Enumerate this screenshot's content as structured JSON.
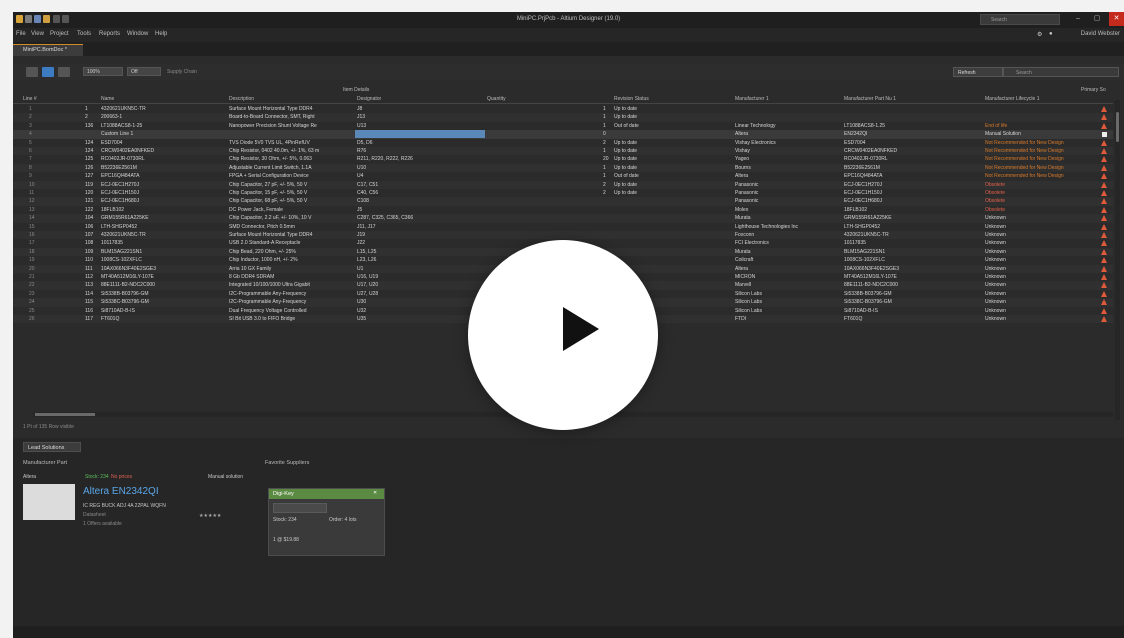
{
  "window": {
    "title": "MiniPC.PrjPcb - Altium Designer (19.0)",
    "search_placeholder": "Search",
    "user_name": "David Webster"
  },
  "menu": [
    "File",
    "View",
    "Project",
    "Tools",
    "Reports",
    "Window",
    "Help"
  ],
  "doc_tab": "MiniPC.BomDoc *",
  "toolbar": {
    "zoom": "100%",
    "filter": "Off",
    "supply_chain": "Supply Chain",
    "refresh_label": "Refresh",
    "search_placeholder": "Search"
  },
  "grid": {
    "group_header": "Item Details",
    "primary_header": "Primary So",
    "columns": [
      "Line #",
      "Name",
      "Description",
      "Designator",
      "Quantity",
      "Revision Status",
      "Manufacturer 1",
      "Manufacturer Part Nu 1",
      "Manufacturer Lifecycle 1"
    ],
    "rows": [
      [
        "1",
        "4320621UKN5C-TR",
        "Surface Mount Horizontal Type DDR4",
        "J8",
        "1",
        "Up to date",
        "",
        "",
        ""
      ],
      [
        "2",
        "200663-1",
        "Board-to-Board Connector, SMT, Right",
        "J13",
        "1",
        "Up to date",
        "",
        "",
        ""
      ],
      [
        "136",
        "LT1088ACS8-1-25",
        "Nanopower Precision Shunt Voltage Re",
        "U13",
        "1",
        "Out of date",
        "Linear Technology",
        "LT1088ACS8-1.25",
        "End of life"
      ],
      [
        "",
        "Custom Line 1",
        "",
        "",
        "0",
        "",
        "Altera",
        "EN2342QI",
        "Manual Solution"
      ],
      [
        "124",
        "ESD7004",
        "TVS Diode 5V0 TVS UL, 4PinRefUV",
        "D5, D6",
        "2",
        "Up to date",
        "Vishay Electronics",
        "ESD7004",
        "Not Recommended for New Design"
      ],
      [
        "124",
        "CRCW0402EA0NFKED",
        "Chip Resistor, 0402 40.0m, +/- 1%, 63 m",
        "R76",
        "1",
        "Up to date",
        "Vishay",
        "CRCW0402EA0NFKED",
        "Not Recommended for New Design"
      ],
      [
        "125",
        "RC0402JR-0730RL",
        "Chip Resistor, 30 Ohm, +/- 5%, 0.063",
        "R211, R220, R222, R226",
        "20",
        "Up to date",
        "Yageo",
        "RC0402JR-0730RL",
        "Not Recommended for New Design"
      ],
      [
        "126",
        "B52236E2561M",
        "Adjustable Current Limit Switch, 1.1A",
        "U10",
        "1",
        "Up to date",
        "Bourns",
        "B52236E2561M",
        "Not Recommended for New Design"
      ],
      [
        "127",
        "EPC16QI484ATA",
        "FPGA + Serial Configuration Device",
        "U4",
        "1",
        "Out of date",
        "Altera",
        "EPC16QI484ATA",
        "Not Recommended for New Design"
      ],
      [
        "119",
        "ECJ-0EC1H270J",
        "Chip Capacitor, 27 pF, +/- 5%, 50 V",
        "C17, C51",
        "2",
        "Up to date",
        "Panasonic",
        "ECJ-0EC1H270J",
        "Obsolete"
      ],
      [
        "120",
        "ECJ-0EC1H150J",
        "Chip Capacitor, 15 pF, +/- 5%, 50 V",
        "C40, C56",
        "2",
        "Up to date",
        "Panasonic",
        "ECJ-0EC1H150J",
        "Obsolete"
      ],
      [
        "121",
        "ECJ-0EC1H680J",
        "Chip Capacitor, 68 pF, +/- 5%, 50 V",
        "C108",
        "",
        "",
        "Panasonic",
        "ECJ-0EC1H680J",
        "Obsolete"
      ],
      [
        "122",
        "18FLB102",
        "DC Power Jack, Female",
        "J5",
        "",
        "",
        "Molex",
        "18FLB102",
        "Obsolete"
      ],
      [
        "104",
        "GRM155R61A225KE",
        "Chip Capacitor, 2.2 uF, +/- 10%, 10 V",
        "C287, C325, C365, C366",
        "",
        "",
        "Murata",
        "GRM155R61A225KE",
        "Unknown"
      ],
      [
        "106",
        "LTH-SHGP0452",
        "SMD Connector, Pitch 0.5mm",
        "J11, J17",
        "",
        "",
        "Lighthouse Technologies Inc",
        "LTH-SHGP0452",
        "Unknown"
      ],
      [
        "107",
        "4320621UKN5C-TR",
        "Surface Mount Horizontal Type DDR4",
        "J19",
        "",
        "",
        "Foxconn",
        "4320621UKN5C-TR",
        "Unknown"
      ],
      [
        "108",
        "10117835",
        "USB 2.0 Standard-A Receptacle",
        "J22",
        "",
        "",
        "FCI Electronics",
        "10117835",
        "Unknown"
      ],
      [
        "109",
        "BLM15AG221SN1",
        "Chip Bead, 220 Ohm, +/- 25%",
        "L15, L25",
        "",
        "",
        "Murata",
        "BLM15AG221SN1",
        "Unknown"
      ],
      [
        "110",
        "1008CS-102XFLC",
        "Chip Inductor, 1000 nH, +/- 2%",
        "L23, L26",
        "",
        "",
        "Coilcraft",
        "1008CS-102XFLC",
        "Unknown"
      ],
      [
        "111",
        "10AX066N3F40E2SGE3",
        "Arria 10 GX Family",
        "U1",
        "",
        "",
        "Altera",
        "10AX066N3F40E2SGE3",
        "Unknown"
      ],
      [
        "112",
        "MT40A512M16LY-107E",
        "8 Gb DDR4 SDRAM",
        "U16, U19",
        "",
        "",
        "MICRON",
        "MT40A512M16LY-107E",
        "Unknown"
      ],
      [
        "113",
        "88E1111-B2-NDC2C000",
        "Integrated 10/100/1000 Ultra Gigabit",
        "U17, U20",
        "",
        "",
        "Marvell",
        "88E1111-B2-NDC2C000",
        "Unknown"
      ],
      [
        "114",
        "Si5338B-B03796-GM",
        "I2C-Programmable Any-Frequency",
        "U27, U28",
        "",
        "",
        "Silicon Labs",
        "Si5338B-B03796-GM",
        "Unknown"
      ],
      [
        "115",
        "Si5338C-B03796-GM",
        "I2C-Programmable Any-Frequency",
        "U30",
        "",
        "",
        "Silicon Labs",
        "Si5338C-B03796-GM",
        "Unknown"
      ],
      [
        "116",
        "Si8710AD-B-IS",
        "Dual Frequency Voltage Controlled",
        "U32",
        "",
        "",
        "Silicon Labs",
        "Si8710AD-B-IS",
        "Unknown"
      ],
      [
        "117",
        "FT601Q",
        "SI Bit USB 3.0 to FIFO Bridge",
        "U35",
        "",
        "",
        "FTDI",
        "FT601Q",
        "Unknown"
      ]
    ],
    "status_line": "1 Pt of 135 Row visible"
  },
  "solutions": {
    "tab_label": "Lead Solutions",
    "mfr_part_header": "Manufacturer Part",
    "favorite_suppliers_header": "Favorite Suppliers",
    "mfr_label": "Altera",
    "stock_label": "Stock: 234",
    "no_price_label": "No prices",
    "manual_solution_label": "Manual solution",
    "part_name": "Altera EN2342QI",
    "part_desc": "IC REG BUCK ADJ 4A 22PAL WQFN",
    "datasheet": "Datasheet",
    "offers": "1 Offers available",
    "rating": "★★★★★",
    "supplier": {
      "name": "Digi-Key",
      "stock_line": "Stock: 234",
      "order_line": "Order: 4 lots",
      "price_line": "1 @ $19.88"
    }
  },
  "colors": {
    "warning": "#e05a3a",
    "lifecycle_warn": "#d87a2a",
    "lifecycle_obsolete": "#e0604a",
    "accent": "#5aa6e8",
    "supplier_green": "#5b8a43"
  }
}
